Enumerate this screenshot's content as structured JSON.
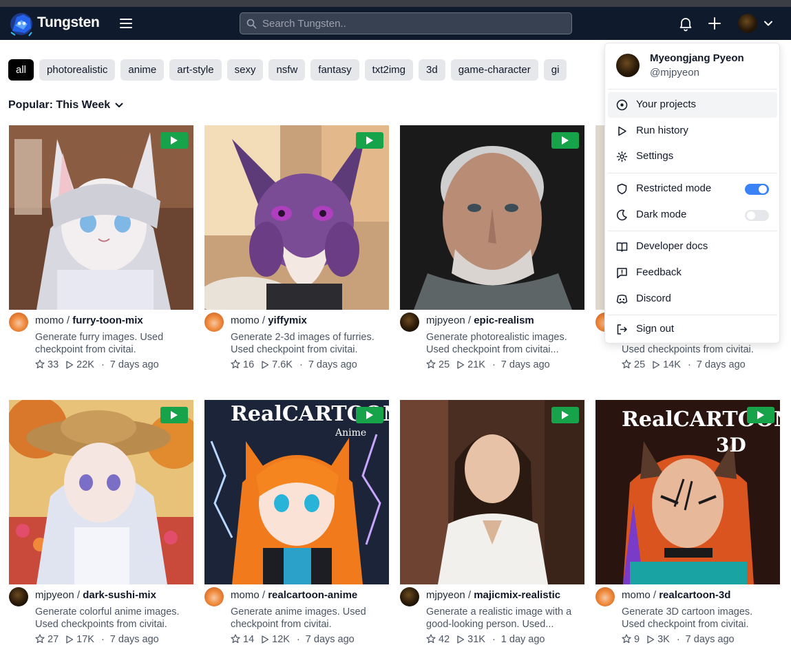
{
  "header": {
    "brand": "Tungsten",
    "search_placeholder": "Search Tungsten.."
  },
  "tags": [
    "all",
    "photorealistic",
    "anime",
    "art-style",
    "sexy",
    "nsfw",
    "fantasy",
    "txt2img",
    "3d",
    "game-character",
    "gi"
  ],
  "active_tag": "all",
  "sort_label": "Popular: This Week",
  "cards": [
    {
      "owner": "momo",
      "slash": " / ",
      "project": "furry-toon-mix",
      "description": "Generate furry images. Used checkpoint from civitai.",
      "stars": "33",
      "runs": "22K",
      "age": "7 days ago"
    },
    {
      "owner": "momo",
      "slash": " / ",
      "project": "yiffymix",
      "description": "Generate 2-3d images of furries. Used checkpoint from civitai.",
      "stars": "16",
      "runs": "7.6K",
      "age": "7 days ago"
    },
    {
      "owner": "mjpyeon",
      "slash": " / ",
      "project": "epic-realism",
      "description": "Generate photorealistic images. Used checkpoint from civitai...",
      "stars": "25",
      "runs": "21K",
      "age": "7 days ago"
    },
    {
      "owner": "",
      "slash": "",
      "project": "",
      "description": "Used checkpoints from civitai.",
      "stars": "25",
      "runs": "14K",
      "age": "7 days ago"
    },
    {
      "owner": "mjpyeon",
      "slash": " / ",
      "project": "dark-sushi-mix",
      "description": "Generate colorful anime images. Used checkpoints from civitai.",
      "stars": "27",
      "runs": "17K",
      "age": "7 days ago"
    },
    {
      "owner": "momo",
      "slash": " / ",
      "project": "realcartoon-anime",
      "description": "Generate anime images. Used checkpoint from civitai.",
      "stars": "14",
      "runs": "12K",
      "age": "7 days ago"
    },
    {
      "owner": "mjpyeon",
      "slash": " / ",
      "project": "majicmix-realistic",
      "description": "Generate a realistic image with a good-looking person. Used...",
      "stars": "42",
      "runs": "31K",
      "age": "1 day ago"
    },
    {
      "owner": "momo",
      "slash": " / ",
      "project": "realcartoon-3d",
      "description": "Generate 3D cartoon images. Used checkpoint from civitai.",
      "stars": "9",
      "runs": "3K",
      "age": "7 days ago"
    }
  ],
  "thumb_text": {
    "realcartoon_anime_logo": "RealCARTOON",
    "realcartoon_anime_sub": "Anime",
    "realcartoon_3d_logo": "RealCARTOON",
    "realcartoon_3d_sub": "3D"
  },
  "user_menu": {
    "name": "Myeongjang Pyeon",
    "handle": "@mjpyeon",
    "items": [
      "Your projects",
      "Run history",
      "Settings",
      "Restricted mode",
      "Dark mode",
      "Developer docs",
      "Feedback",
      "Discord",
      "Sign out"
    ],
    "restricted_mode": true,
    "dark_mode": false
  },
  "colors": {
    "navbar": "#0f1b2d",
    "play_button": "#16a34a",
    "toggle_on": "#3b82f6"
  }
}
